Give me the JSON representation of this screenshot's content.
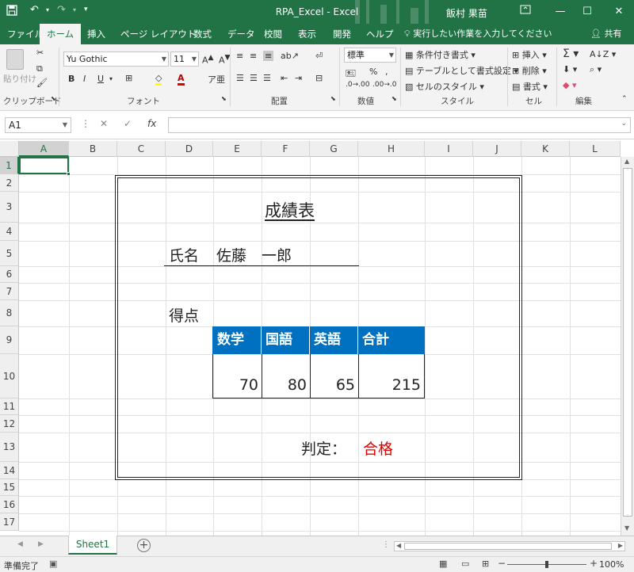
{
  "window": {
    "title": "RPA_Excel  -  Excel",
    "user": "飯村 果苗",
    "qa_save_icon": "save-icon",
    "qa_undo_icon": "undo-icon",
    "qa_redo_icon": "redo-icon",
    "qa_more": "▾"
  },
  "tabs": [
    {
      "label": "ファイル"
    },
    {
      "label": "ホーム"
    },
    {
      "label": "挿入"
    },
    {
      "label": "ページ レイアウト"
    },
    {
      "label": "数式"
    },
    {
      "label": "データ"
    },
    {
      "label": "校閲"
    },
    {
      "label": "表示"
    },
    {
      "label": "開発"
    },
    {
      "label": "ヘルプ"
    }
  ],
  "tell_me": "実行したい作業を入力してください",
  "share": "共有",
  "ribbon": {
    "paste": "貼り付け",
    "font_name": "Yu Gothic",
    "font_size": "11",
    "number_format": "標準",
    "cond_format": "条件付き書式",
    "format_table": "テーブルとして書式設定",
    "cell_style": "セルのスタイル",
    "insert": "挿入",
    "delete": "削除",
    "format": "書式",
    "bold": "B",
    "italic": "I",
    "underline": "U",
    "groups": {
      "clipboard": "クリップボード",
      "font": "フォント",
      "alignment": "配置",
      "number": "数値",
      "styles": "スタイル",
      "cells": "セル",
      "editing": "編集"
    }
  },
  "formula_bar": {
    "name_box": "A1",
    "fx": "fx",
    "value": ""
  },
  "columns": [
    "A",
    "B",
    "C",
    "D",
    "E",
    "F",
    "G",
    "H",
    "I",
    "J",
    "K",
    "L"
  ],
  "rows": [
    "1",
    "2",
    "3",
    "4",
    "5",
    "6",
    "7",
    "8",
    "9",
    "10",
    "11",
    "12",
    "13",
    "14",
    "15",
    "16",
    "17"
  ],
  "sheet": {
    "title": "成績表",
    "name_label": "氏名",
    "name_value": "佐藤　一郎",
    "score_label": "得点",
    "table": {
      "headers": [
        "数学",
        "国語",
        "英語",
        "合計"
      ],
      "values": [
        "70",
        "80",
        "65",
        "215"
      ]
    },
    "judge_label": "判定：",
    "judge_value": "合格",
    "judge_color": "#e00000",
    "header_color": "#0070c0"
  },
  "sheet_tabs": {
    "active": "Sheet1",
    "add": "+"
  },
  "status": {
    "ready": "準備完了",
    "zoom": "100%"
  }
}
